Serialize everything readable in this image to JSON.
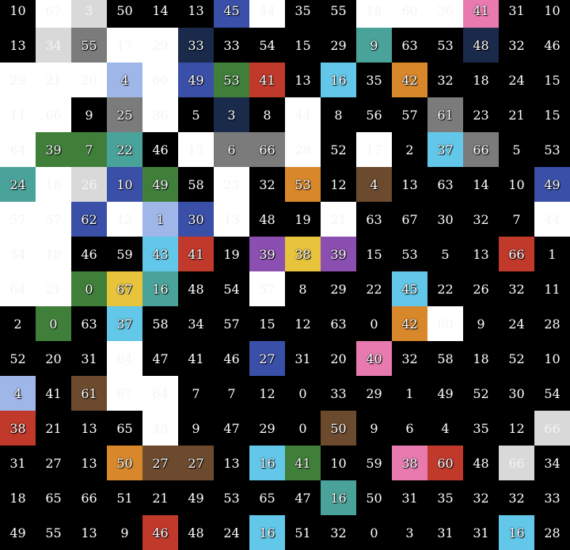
{
  "colors": {
    "k": "#000000",
    "w": "#ffffff",
    "g": "#d9d9d9",
    "b": "#3a4fa8",
    "c": "#62c7e8",
    "t": "#4aa39a",
    "G": "#3f7f3a",
    "r": "#c0392b",
    "o": "#d8882a",
    "y": "#e8c43c",
    "p": "#8a4fb0",
    "n": "#6b4a2e",
    "m": "#7b7b7b",
    "P": "#e87ab0",
    "d": "#1a2a4a",
    "l": "#9fb6e8"
  },
  "grid": [
    {
      "cells": [
        "10",
        "67",
        "3",
        "50",
        "14",
        "13",
        "45",
        "44",
        "35",
        "55",
        "18",
        "60",
        "36",
        "41",
        "31",
        "10"
      ],
      "bg": [
        "k",
        "w",
        "g",
        "k",
        "k",
        "k",
        "b",
        "w",
        "k",
        "k",
        "w",
        "w",
        "w",
        "P",
        "k",
        "k"
      ]
    },
    {
      "cells": [
        "13",
        "34",
        "55",
        "17",
        "29",
        "33",
        "33",
        "54",
        "15",
        "29",
        "9",
        "63",
        "53",
        "48",
        "32",
        "46"
      ],
      "bg": [
        "k",
        "g",
        "m",
        "w",
        "w",
        "d",
        "k",
        "k",
        "k",
        "k",
        "t",
        "k",
        "k",
        "d",
        "k",
        "k"
      ]
    },
    {
      "cells": [
        "29",
        "21",
        "20",
        "4",
        "60",
        "49",
        "53",
        "41",
        "13",
        "16",
        "35",
        "42",
        "32",
        "18",
        "24",
        "15"
      ],
      "bg": [
        "w",
        "w",
        "w",
        "l",
        "w",
        "b",
        "G",
        "r",
        "k",
        "c",
        "k",
        "o",
        "k",
        "k",
        "k",
        "k"
      ]
    },
    {
      "cells": [
        "11",
        "66",
        "9",
        "25",
        "36",
        "5",
        "3",
        "8",
        "44",
        "8",
        "56",
        "57",
        "61",
        "23",
        "21",
        "15"
      ],
      "bg": [
        "w",
        "w",
        "k",
        "m",
        "w",
        "k",
        "d",
        "k",
        "w",
        "k",
        "k",
        "k",
        "m",
        "k",
        "k",
        "k"
      ]
    },
    {
      "cells": [
        "64",
        "39",
        "7",
        "22",
        "46",
        "13",
        "6",
        "66",
        "28",
        "52",
        "17",
        "2",
        "37",
        "66",
        "5",
        "53"
      ],
      "bg": [
        "w",
        "G",
        "G",
        "t",
        "k",
        "w",
        "m",
        "m",
        "w",
        "k",
        "w",
        "k",
        "c",
        "m",
        "k",
        "k"
      ]
    },
    {
      "cells": [
        "24",
        "18",
        "26",
        "10",
        "49",
        "58",
        "23",
        "32",
        "53",
        "12",
        "4",
        "13",
        "63",
        "14",
        "10",
        "49"
      ],
      "bg": [
        "t",
        "w",
        "g",
        "b",
        "G",
        "k",
        "w",
        "k",
        "o",
        "k",
        "n",
        "k",
        "k",
        "k",
        "k",
        "b"
      ]
    },
    {
      "cells": [
        "57",
        "57",
        "62",
        "12",
        "1",
        "30",
        "13",
        "48",
        "19",
        "21",
        "63",
        "67",
        "30",
        "32",
        "7",
        "44"
      ],
      "bg": [
        "w",
        "w",
        "b",
        "w",
        "l",
        "b",
        "w",
        "k",
        "k",
        "w",
        "k",
        "k",
        "k",
        "k",
        "k",
        "w"
      ]
    },
    {
      "cells": [
        "34",
        "18",
        "46",
        "59",
        "43",
        "41",
        "19",
        "39",
        "38",
        "39",
        "15",
        "53",
        "5",
        "13",
        "66",
        "1"
      ],
      "bg": [
        "w",
        "w",
        "k",
        "k",
        "c",
        "r",
        "k",
        "p",
        "y",
        "p",
        "k",
        "k",
        "k",
        "k",
        "r",
        "k"
      ]
    },
    {
      "cells": [
        "64",
        "21",
        "0",
        "67",
        "16",
        "48",
        "54",
        "57",
        "8",
        "29",
        "22",
        "45",
        "22",
        "26",
        "32",
        "11"
      ],
      "bg": [
        "w",
        "w",
        "G",
        "y",
        "t",
        "k",
        "k",
        "w",
        "k",
        "k",
        "k",
        "c",
        "k",
        "k",
        "k",
        "k"
      ]
    },
    {
      "cells": [
        "2",
        "0",
        "63",
        "37",
        "58",
        "34",
        "57",
        "15",
        "12",
        "63",
        "0",
        "42",
        "60",
        "9",
        "24",
        "28"
      ],
      "bg": [
        "k",
        "G",
        "k",
        "c",
        "k",
        "k",
        "k",
        "k",
        "k",
        "k",
        "k",
        "o",
        "w",
        "k",
        "k",
        "k"
      ]
    },
    {
      "cells": [
        "52",
        "20",
        "31",
        "64",
        "47",
        "41",
        "46",
        "27",
        "31",
        "20",
        "40",
        "32",
        "58",
        "18",
        "52",
        "10"
      ],
      "bg": [
        "k",
        "k",
        "k",
        "w",
        "k",
        "k",
        "k",
        "b",
        "k",
        "k",
        "P",
        "k",
        "k",
        "k",
        "k",
        "k"
      ]
    },
    {
      "cells": [
        "4",
        "41",
        "61",
        "67",
        "64",
        "7",
        "7",
        "12",
        "0",
        "33",
        "29",
        "1",
        "49",
        "52",
        "30",
        "54"
      ],
      "bg": [
        "l",
        "k",
        "n",
        "w",
        "w",
        "k",
        "k",
        "k",
        "k",
        "k",
        "k",
        "k",
        "k",
        "k",
        "k",
        "k"
      ]
    },
    {
      "cells": [
        "38",
        "21",
        "13",
        "65",
        "43",
        "9",
        "47",
        "29",
        "0",
        "50",
        "9",
        "6",
        "4",
        "35",
        "12",
        "66"
      ],
      "bg": [
        "r",
        "k",
        "k",
        "k",
        "w",
        "k",
        "k",
        "k",
        "k",
        "n",
        "k",
        "k",
        "k",
        "k",
        "k",
        "g"
      ]
    },
    {
      "cells": [
        "31",
        "27",
        "13",
        "50",
        "27",
        "27",
        "13",
        "16",
        "41",
        "10",
        "59",
        "38",
        "60",
        "48",
        "66",
        "34"
      ],
      "bg": [
        "k",
        "k",
        "k",
        "o",
        "n",
        "n",
        "k",
        "c",
        "G",
        "k",
        "k",
        "P",
        "r",
        "k",
        "g",
        "k"
      ]
    },
    {
      "cells": [
        "18",
        "65",
        "66",
        "51",
        "21",
        "49",
        "53",
        "65",
        "47",
        "16",
        "50",
        "31",
        "35",
        "32",
        "32",
        "33"
      ],
      "bg": [
        "k",
        "k",
        "k",
        "k",
        "k",
        "k",
        "k",
        "k",
        "k",
        "t",
        "k",
        "k",
        "k",
        "k",
        "k",
        "k"
      ]
    },
    {
      "cells": [
        "49",
        "55",
        "13",
        "9",
        "46",
        "48",
        "24",
        "16",
        "51",
        "32",
        "0",
        "3",
        "31",
        "31",
        "16",
        "28"
      ],
      "bg": [
        "k",
        "k",
        "k",
        "k",
        "r",
        "k",
        "k",
        "c",
        "k",
        "k",
        "k",
        "k",
        "k",
        "k",
        "c",
        "k"
      ]
    }
  ]
}
